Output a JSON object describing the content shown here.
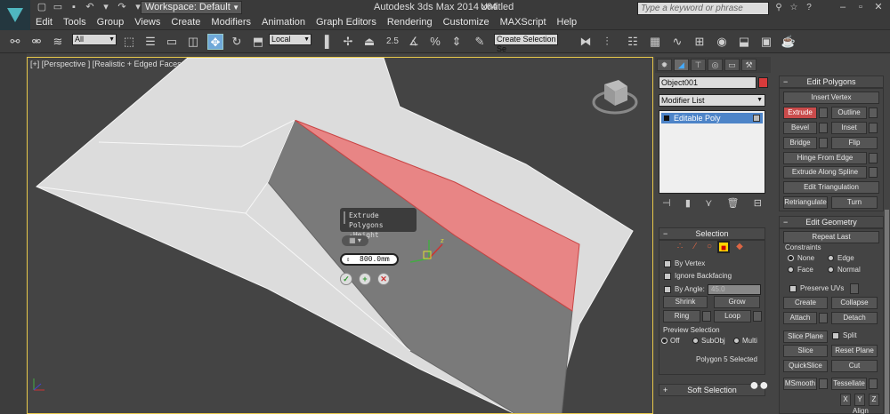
{
  "titlebar": {
    "workspace": "Workspace: Default",
    "app_title": "Autodesk 3ds Max  2014 x64",
    "doc_title": "Untitled",
    "search_placeholder": "Type a keyword or phrase"
  },
  "menu": [
    "Edit",
    "Tools",
    "Group",
    "Views",
    "Create",
    "Modifiers",
    "Animation",
    "Graph Editors",
    "Rendering",
    "Customize",
    "MAXScript",
    "Help"
  ],
  "toolbar": {
    "filter": "All",
    "ref_coord": "Local",
    "snap_value": "2.5",
    "selection_set": "Create Selection Se"
  },
  "viewport": {
    "label": "[+] [Perspective ] [Realistic + Edged Faces ]",
    "caddy_title_line1": "Extrude Polygons",
    "caddy_title_line2": "-Height",
    "caddy_value": "800.0mm",
    "colors": {
      "selected_face": "#e88585",
      "face_light": "#dcdcdc",
      "face_dark": "#7a7a7a",
      "background": "#444444"
    }
  },
  "command_panel": {
    "object_name": "Object001",
    "object_color": "#d83b3b",
    "modifier_list": "Modifier List",
    "stack_item": "Editable Poly",
    "selection": {
      "title": "Selection",
      "by_vertex": "By Vertex",
      "ignore_backfacing": "Ignore Backfacing",
      "by_angle": "By Angle:",
      "angle_value": "45.0",
      "shrink": "Shrink",
      "grow": "Grow",
      "ring": "Ring",
      "loop": "Loop",
      "preview_title": "Preview Selection",
      "preview_off": "Off",
      "preview_subobj": "SubObj",
      "preview_multi": "Multi",
      "status": "Polygon 5 Selected"
    },
    "soft_selection": "Soft Selection"
  },
  "edit_polygons": {
    "title": "Edit Polygons",
    "insert_vertex": "Insert Vertex",
    "extrude": "Extrude",
    "outline": "Outline",
    "bevel": "Bevel",
    "inset": "Inset",
    "bridge": "Bridge",
    "flip": "Flip",
    "hinge": "Hinge From Edge",
    "extrude_spline": "Extrude Along Spline",
    "edit_tri": "Edit Triangulation",
    "retriangulate": "Retriangulate",
    "turn": "Turn"
  },
  "edit_geometry": {
    "title": "Edit Geometry",
    "repeat_last": "Repeat Last",
    "constraints": "Constraints",
    "none": "None",
    "edge": "Edge",
    "face": "Face",
    "normal": "Normal",
    "preserve_uvs": "Preserve UVs",
    "create": "Create",
    "collapse": "Collapse",
    "attach": "Attach",
    "detach": "Detach",
    "slice_plane": "Slice Plane",
    "split": "Split",
    "slice": "Slice",
    "reset_plane": "Reset Plane",
    "quickslice": "QuickSlice",
    "cut": "Cut",
    "msmooth": "MSmooth",
    "tessellate": "Tessellate",
    "x": "X",
    "y": "Y",
    "z": "Z",
    "align": "Align"
  }
}
